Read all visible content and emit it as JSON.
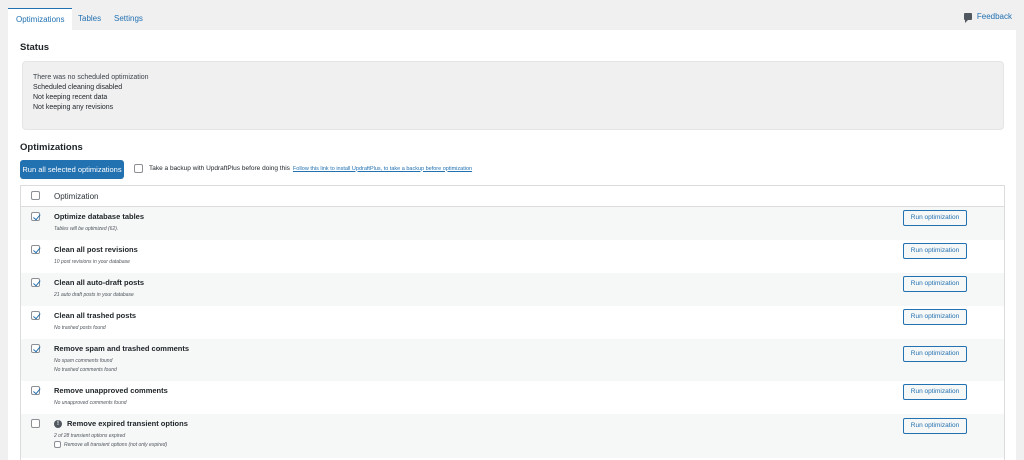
{
  "tabs": [
    {
      "label": "Optimizations",
      "active": true
    },
    {
      "label": "Tables",
      "active": false
    },
    {
      "label": "Settings",
      "active": false
    }
  ],
  "feedback_label": "Feedback",
  "status": {
    "title": "Status",
    "lines": [
      "There was no scheduled optimization",
      "Scheduled cleaning disabled",
      "Not keeping recent data",
      "Not keeping any revisions"
    ]
  },
  "optimizations": {
    "title": "Optimizations",
    "run_all_label": "Run all selected optimizations",
    "backup_text": "Take a backup with UpdraftPlus before doing this",
    "backup_link": "Follow this link to install UpdraftPlus, to take a backup before optimization",
    "column_header": "Optimization",
    "run_label": "Run optimization",
    "rows": [
      {
        "title": "Optimize database tables",
        "checked": true,
        "subs": [
          "Tables will be optimized (62)."
        ]
      },
      {
        "title": "Clean all post revisions",
        "checked": true,
        "subs": [
          "10 post revisions in your database"
        ]
      },
      {
        "title": "Clean all auto-draft posts",
        "checked": true,
        "subs": [
          "21 auto draft posts in your database"
        ]
      },
      {
        "title": "Clean all trashed posts",
        "checked": true,
        "subs": [
          "No trashed posts found"
        ]
      },
      {
        "title": "Remove spam and trashed comments",
        "checked": true,
        "subs": [
          "No spam comments found",
          "No trashed comments found"
        ]
      },
      {
        "title": "Remove unapproved comments",
        "checked": true,
        "subs": [
          "No unapproved comments found"
        ]
      },
      {
        "title": "Remove expired transient options",
        "checked": false,
        "info_icon": true,
        "subs": [
          "2 of 28 transient options expired"
        ],
        "sub_checkbox": "Remove all transient options (not only expired)"
      }
    ]
  },
  "colors": {
    "accent": "#2271b1",
    "page_bg": "#f0f0f1",
    "panel_bg": "#ffffff"
  }
}
